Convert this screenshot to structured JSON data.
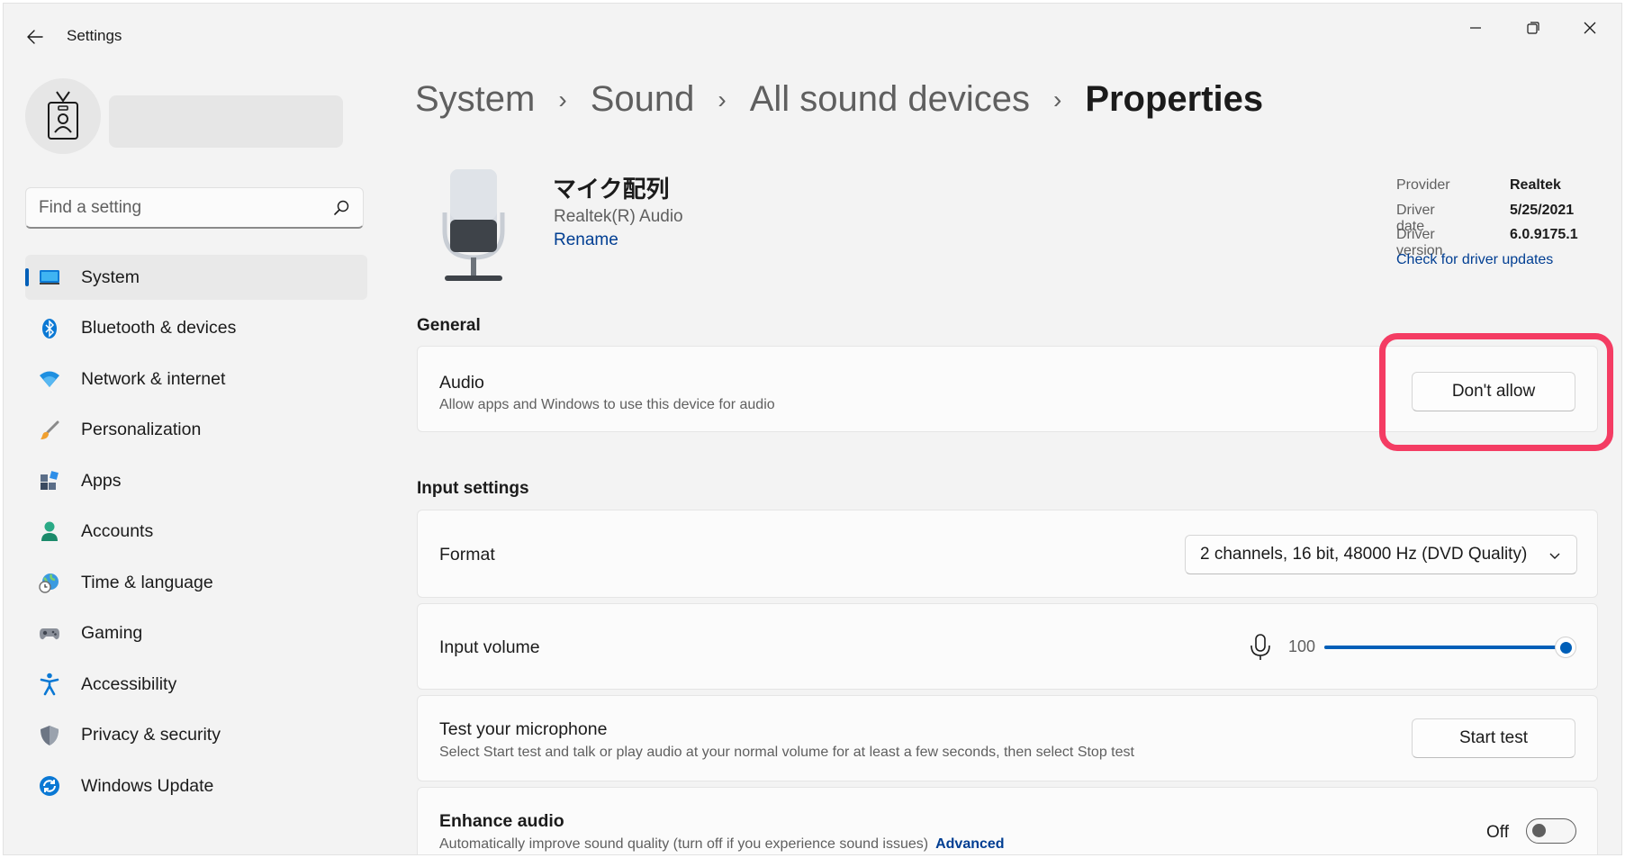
{
  "window": {
    "title": "Settings",
    "controls": [
      "minimize-icon",
      "maximize-icon",
      "close-icon"
    ]
  },
  "search": {
    "placeholder": "Find a setting"
  },
  "sidebar": {
    "items": [
      {
        "label": "System",
        "icon": "system-icon",
        "active": true
      },
      {
        "label": "Bluetooth & devices",
        "icon": "bluetooth-icon"
      },
      {
        "label": "Network & internet",
        "icon": "wifi-icon"
      },
      {
        "label": "Personalization",
        "icon": "brush-icon"
      },
      {
        "label": "Apps",
        "icon": "apps-icon"
      },
      {
        "label": "Accounts",
        "icon": "accounts-icon"
      },
      {
        "label": "Time & language",
        "icon": "globe-clock-icon"
      },
      {
        "label": "Gaming",
        "icon": "gamepad-icon"
      },
      {
        "label": "Accessibility",
        "icon": "accessibility-icon"
      },
      {
        "label": "Privacy & security",
        "icon": "shield-icon"
      },
      {
        "label": "Windows Update",
        "icon": "update-icon"
      }
    ]
  },
  "breadcrumb": {
    "items": [
      "System",
      "Sound",
      "All sound devices"
    ],
    "current": "Properties",
    "separator": "›"
  },
  "device": {
    "name": "マイク配列",
    "subtitle": "Realtek(R) Audio",
    "rename": "Rename",
    "icon": "microphone-device-icon"
  },
  "driver": {
    "provider_label": "Provider",
    "provider": "Realtek",
    "date_label": "Driver date",
    "date": "5/25/2021",
    "version_label": "Driver version",
    "version": "6.0.9175.1",
    "update_link": "Check for driver updates"
  },
  "general": {
    "section_title": "General",
    "audio": {
      "title": "Audio",
      "description": "Allow apps and Windows to use this device for audio",
      "button": "Don't allow"
    }
  },
  "input_settings": {
    "section_title": "Input settings",
    "format": {
      "title": "Format",
      "selected": "2 channels, 16 bit, 48000 Hz (DVD Quality)"
    },
    "volume": {
      "title": "Input volume",
      "value": "100",
      "level": 1.0
    },
    "test": {
      "title": "Test your microphone",
      "description": "Select Start test and talk or play audio at your normal volume for at least a few seconds, then select Stop test",
      "button": "Start test"
    },
    "enhance": {
      "title": "Enhance audio",
      "description": "Automatically improve sound quality (turn off if you experience sound issues)",
      "link": "Advanced",
      "state": "Off"
    }
  },
  "colors": {
    "accent": "#005fb8",
    "link": "#003e92",
    "highlight": "#f43c63",
    "background": "#f3f3f3"
  }
}
